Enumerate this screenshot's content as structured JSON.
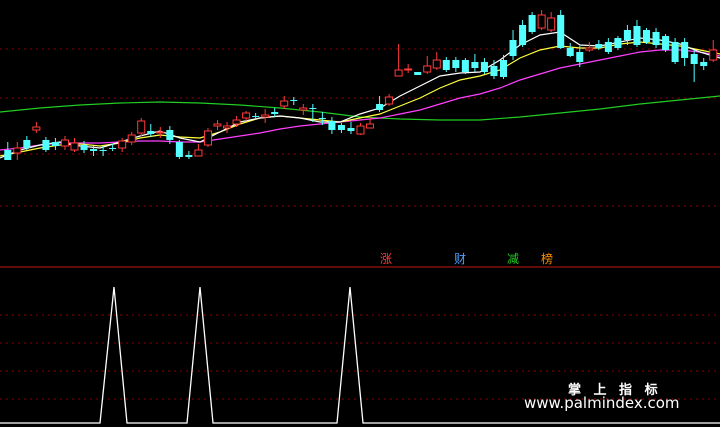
{
  "colors": {
    "background": "#000000",
    "grid": "#8b0000",
    "divider": "#c01818",
    "candle_up": "#ff3b3b",
    "candle_down": "#54ffff",
    "ma_short": "#ffffff",
    "ma_mid": "#ffff40",
    "ma_long": "#ff40ff",
    "ma_slow": "#22cc22",
    "signal_line": "#ffffff"
  },
  "legend": [
    {
      "label": "涨",
      "color": "#ff3b3b"
    },
    {
      "label": "财",
      "color": "#4aa0ff"
    },
    {
      "label": "减",
      "color": "#22cc22"
    },
    {
      "label": "榜",
      "color": "#ff8c00"
    }
  ],
  "watermark": {
    "name": "掌 上 指 标",
    "url": "www.palmindex.com"
  },
  "chart_data": [
    {
      "type": "candlestick",
      "panel": "price",
      "lines": [
        "ma_short",
        "ma_mid",
        "ma_long",
        "ma_slow"
      ],
      "candles": [
        [
          150,
          160,
          142,
          160
        ],
        [
          153,
          148,
          142,
          160
        ],
        [
          140,
          148,
          136,
          150
        ],
        [
          130,
          127,
          122,
          133
        ],
        [
          140,
          150,
          137,
          152
        ],
        [
          142,
          146,
          138,
          150
        ],
        [
          146,
          140,
          136,
          150
        ],
        [
          150,
          143,
          138,
          152
        ],
        [
          145,
          150,
          141,
          153
        ],
        [
          149,
          151,
          146,
          156
        ],
        [
          150,
          151,
          146,
          156
        ],
        [
          148,
          149,
          144,
          151
        ],
        [
          148,
          141,
          138,
          152
        ],
        [
          142,
          135,
          132,
          145
        ],
        [
          133,
          121,
          118,
          136
        ],
        [
          131,
          134,
          124,
          137
        ],
        [
          133,
          132,
          127,
          138
        ],
        [
          130,
          140,
          126,
          144
        ],
        [
          142,
          157,
          140,
          159
        ],
        [
          155,
          157,
          151,
          159
        ],
        [
          156,
          150,
          144,
          156
        ],
        [
          145,
          131,
          128,
          147
        ],
        [
          126,
          124,
          120,
          130
        ],
        [
          128,
          126,
          122,
          133
        ],
        [
          124,
          120,
          116,
          127
        ],
        [
          118,
          113,
          111,
          121
        ],
        [
          116,
          117,
          113,
          119
        ],
        [
          117,
          115,
          109,
          123
        ],
        [
          112,
          114,
          108,
          117
        ],
        [
          106,
          101,
          96,
          109
        ],
        [
          100,
          101,
          97,
          105
        ],
        [
          110,
          108,
          104,
          115
        ],
        [
          108,
          109,
          104,
          122
        ],
        [
          118,
          118,
          112,
          125
        ],
        [
          121,
          130,
          117,
          134
        ],
        [
          125,
          130,
          123,
          133
        ],
        [
          128,
          131,
          122,
          134
        ],
        [
          134,
          126,
          123,
          135
        ],
        [
          128,
          124,
          117,
          128
        ],
        [
          104,
          110,
          96,
          112
        ],
        [
          104,
          97,
          94,
          106
        ],
        [
          76,
          70,
          44,
          76
        ],
        [
          70,
          69,
          64,
          73
        ],
        [
          72,
          75,
          72,
          75
        ],
        [
          72,
          66,
          56,
          74
        ],
        [
          68,
          60,
          52,
          70
        ],
        [
          60,
          70,
          57,
          72
        ],
        [
          60,
          68,
          57,
          72
        ],
        [
          60,
          72,
          58,
          74
        ],
        [
          62,
          68,
          54,
          72
        ],
        [
          62,
          72,
          58,
          74
        ],
        [
          66,
          76,
          60,
          79
        ],
        [
          60,
          77,
          55,
          79
        ],
        [
          40,
          56,
          30,
          60
        ],
        [
          25,
          45,
          20,
          47
        ],
        [
          15,
          32,
          12,
          34
        ],
        [
          28,
          15,
          10,
          30
        ],
        [
          30,
          18,
          12,
          32
        ],
        [
          15,
          48,
          10,
          49
        ],
        [
          48,
          56,
          43,
          57
        ],
        [
          52,
          62,
          46,
          67
        ],
        [
          50,
          48,
          42,
          52
        ],
        [
          44,
          48,
          40,
          50
        ],
        [
          42,
          52,
          38,
          54
        ],
        [
          38,
          48,
          36,
          50
        ],
        [
          30,
          40,
          25,
          45
        ],
        [
          26,
          45,
          20,
          47
        ],
        [
          30,
          42,
          28,
          44
        ],
        [
          32,
          45,
          28,
          48
        ],
        [
          36,
          50,
          34,
          52
        ],
        [
          42,
          62,
          38,
          64
        ],
        [
          42,
          58,
          38,
          66
        ],
        [
          54,
          64,
          50,
          82
        ],
        [
          62,
          66,
          58,
          70
        ],
        [
          60,
          50,
          40,
          62
        ]
      ],
      "ma_points": {
        "ma_short": [
          [
            0,
            158
          ],
          [
            20,
            150
          ],
          [
            40,
            145
          ],
          [
            60,
            142
          ],
          [
            80,
            146
          ],
          [
            100,
            148
          ],
          [
            120,
            142
          ],
          [
            140,
            136
          ],
          [
            160,
            131
          ],
          [
            180,
            138
          ],
          [
            200,
            142
          ],
          [
            220,
            132
          ],
          [
            240,
            122
          ],
          [
            260,
            118
          ],
          [
            280,
            116
          ],
          [
            300,
            118
          ],
          [
            320,
            122
          ],
          [
            340,
            122
          ],
          [
            360,
            114
          ],
          [
            380,
            108
          ],
          [
            400,
            96
          ],
          [
            420,
            86
          ],
          [
            440,
            76
          ],
          [
            460,
            73
          ],
          [
            480,
            72
          ],
          [
            500,
            60
          ],
          [
            520,
            45
          ],
          [
            540,
            35
          ],
          [
            560,
            32
          ],
          [
            580,
            45
          ],
          [
            600,
            46
          ],
          [
            620,
            42
          ],
          [
            640,
            38
          ],
          [
            660,
            40
          ],
          [
            680,
            44
          ],
          [
            700,
            52
          ],
          [
            720,
            58
          ]
        ],
        "ma_mid": [
          [
            0,
            156
          ],
          [
            20,
            152
          ],
          [
            40,
            148
          ],
          [
            60,
            145
          ],
          [
            80,
            144
          ],
          [
            100,
            146
          ],
          [
            120,
            143
          ],
          [
            140,
            138
          ],
          [
            160,
            135
          ],
          [
            180,
            137
          ],
          [
            200,
            138
          ],
          [
            220,
            132
          ],
          [
            240,
            124
          ],
          [
            260,
            118
          ],
          [
            280,
            116
          ],
          [
            300,
            118
          ],
          [
            320,
            120
          ],
          [
            340,
            122
          ],
          [
            360,
            118
          ],
          [
            380,
            114
          ],
          [
            400,
            106
          ],
          [
            420,
            98
          ],
          [
            440,
            88
          ],
          [
            460,
            80
          ],
          [
            480,
            76
          ],
          [
            500,
            70
          ],
          [
            520,
            58
          ],
          [
            540,
            50
          ],
          [
            560,
            46
          ],
          [
            580,
            48
          ],
          [
            600,
            48
          ],
          [
            620,
            44
          ],
          [
            640,
            42
          ],
          [
            660,
            44
          ],
          [
            680,
            46
          ],
          [
            700,
            50
          ],
          [
            720,
            54
          ]
        ],
        "ma_long": [
          [
            0,
            150
          ],
          [
            20,
            148
          ],
          [
            40,
            145
          ],
          [
            60,
            143
          ],
          [
            80,
            143
          ],
          [
            100,
            143
          ],
          [
            120,
            142
          ],
          [
            140,
            141
          ],
          [
            160,
            141
          ],
          [
            180,
            142
          ],
          [
            200,
            142
          ],
          [
            220,
            139
          ],
          [
            240,
            136
          ],
          [
            260,
            133
          ],
          [
            280,
            129
          ],
          [
            300,
            126
          ],
          [
            320,
            124
          ],
          [
            340,
            122
          ],
          [
            360,
            120
          ],
          [
            380,
            118
          ],
          [
            400,
            114
          ],
          [
            420,
            110
          ],
          [
            440,
            104
          ],
          [
            460,
            98
          ],
          [
            480,
            94
          ],
          [
            500,
            88
          ],
          [
            520,
            80
          ],
          [
            540,
            74
          ],
          [
            560,
            68
          ],
          [
            580,
            64
          ],
          [
            600,
            60
          ],
          [
            620,
            56
          ],
          [
            640,
            52
          ],
          [
            660,
            50
          ],
          [
            680,
            50
          ],
          [
            700,
            52
          ],
          [
            720,
            56
          ]
        ],
        "ma_slow": [
          [
            0,
            112
          ],
          [
            40,
            108
          ],
          [
            80,
            105
          ],
          [
            120,
            103
          ],
          [
            160,
            102
          ],
          [
            200,
            103
          ],
          [
            240,
            105
          ],
          [
            280,
            108
          ],
          [
            320,
            112
          ],
          [
            360,
            117
          ],
          [
            400,
            119
          ],
          [
            440,
            120
          ],
          [
            480,
            120
          ],
          [
            520,
            117
          ],
          [
            560,
            113
          ],
          [
            600,
            109
          ],
          [
            640,
            104
          ],
          [
            680,
            100
          ],
          [
            720,
            96
          ]
        ]
      }
    },
    {
      "type": "line",
      "panel": "signal",
      "x": [
        0,
        100,
        114,
        127,
        187,
        200,
        213,
        337,
        350,
        363,
        720
      ],
      "y": [
        0,
        0,
        1,
        0,
        0,
        1,
        0,
        0,
        1,
        0,
        0
      ]
    }
  ]
}
